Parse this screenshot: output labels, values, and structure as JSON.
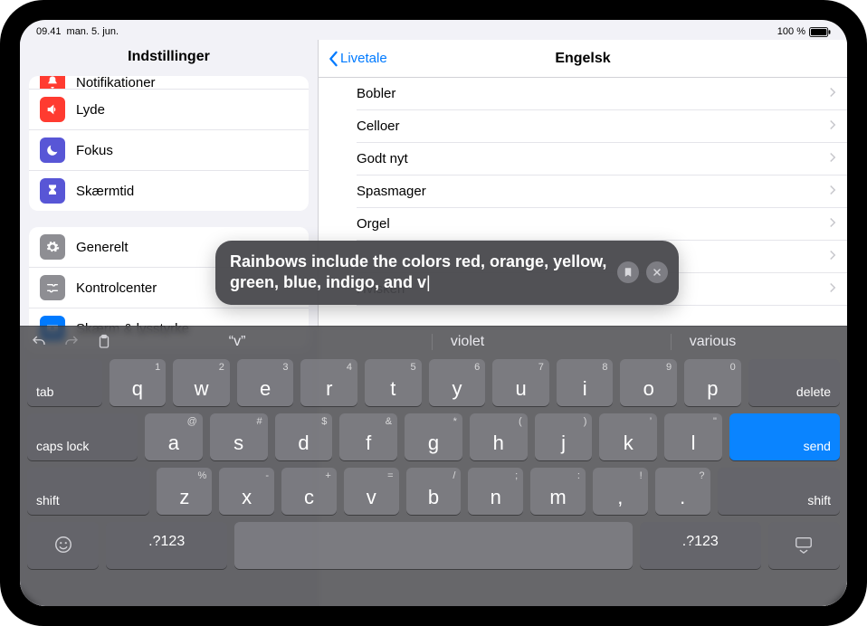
{
  "status": {
    "time": "09.41",
    "date": "man. 5. jun.",
    "battery_pct": "100 %"
  },
  "sidebar": {
    "title": "Indstillinger",
    "group1": [
      {
        "label": "Notifikationer"
      },
      {
        "label": "Lyde"
      },
      {
        "label": "Fokus"
      },
      {
        "label": "Skærmtid"
      }
    ],
    "group2": [
      {
        "label": "Generelt"
      },
      {
        "label": "Kontrolcenter"
      },
      {
        "label": "Skærm & lysstyrke"
      }
    ]
  },
  "detail": {
    "back_label": "Livetale",
    "title": "Engelsk",
    "rows": [
      "Bobler",
      "Celloer",
      "Godt nyt",
      "Spasmager",
      "Orgel",
      "",
      "Hvisken"
    ]
  },
  "live_speech": {
    "text": "Rainbows include the colors red, orange, yellow, green, blue, indigo, and v"
  },
  "keyboard": {
    "suggestions": [
      "“v”",
      "violet",
      "various"
    ],
    "row1": {
      "left_fn": "tab",
      "right_fn": "delete",
      "keys": [
        {
          "m": "q",
          "s": "1"
        },
        {
          "m": "w",
          "s": "2"
        },
        {
          "m": "e",
          "s": "3"
        },
        {
          "m": "r",
          "s": "4"
        },
        {
          "m": "t",
          "s": "5"
        },
        {
          "m": "y",
          "s": "6"
        },
        {
          "m": "u",
          "s": "7"
        },
        {
          "m": "i",
          "s": "8"
        },
        {
          "m": "o",
          "s": "9"
        },
        {
          "m": "p",
          "s": "0"
        }
      ]
    },
    "row2": {
      "left_fn": "caps lock",
      "right_fn": "send",
      "keys": [
        {
          "m": "a",
          "s": "@"
        },
        {
          "m": "s",
          "s": "#"
        },
        {
          "m": "d",
          "s": "$"
        },
        {
          "m": "f",
          "s": "&"
        },
        {
          "m": "g",
          "s": "*"
        },
        {
          "m": "h",
          "s": "("
        },
        {
          "m": "j",
          "s": ")"
        },
        {
          "m": "k",
          "s": "’"
        },
        {
          "m": "l",
          "s": "\""
        }
      ]
    },
    "row3": {
      "left_fn": "shift",
      "right_fn": "shift",
      "keys": [
        {
          "m": "z",
          "s": "%"
        },
        {
          "m": "x",
          "s": "-"
        },
        {
          "m": "c",
          "s": "+"
        },
        {
          "m": "v",
          "s": "="
        },
        {
          "m": "b",
          "s": "/"
        },
        {
          "m": "n",
          "s": ";"
        },
        {
          "m": "m",
          "s": ":"
        },
        {
          "m": ",",
          "s": "!"
        },
        {
          "m": ".",
          "s": "?"
        }
      ]
    },
    "row4": {
      "numkey": ".?123"
    }
  }
}
